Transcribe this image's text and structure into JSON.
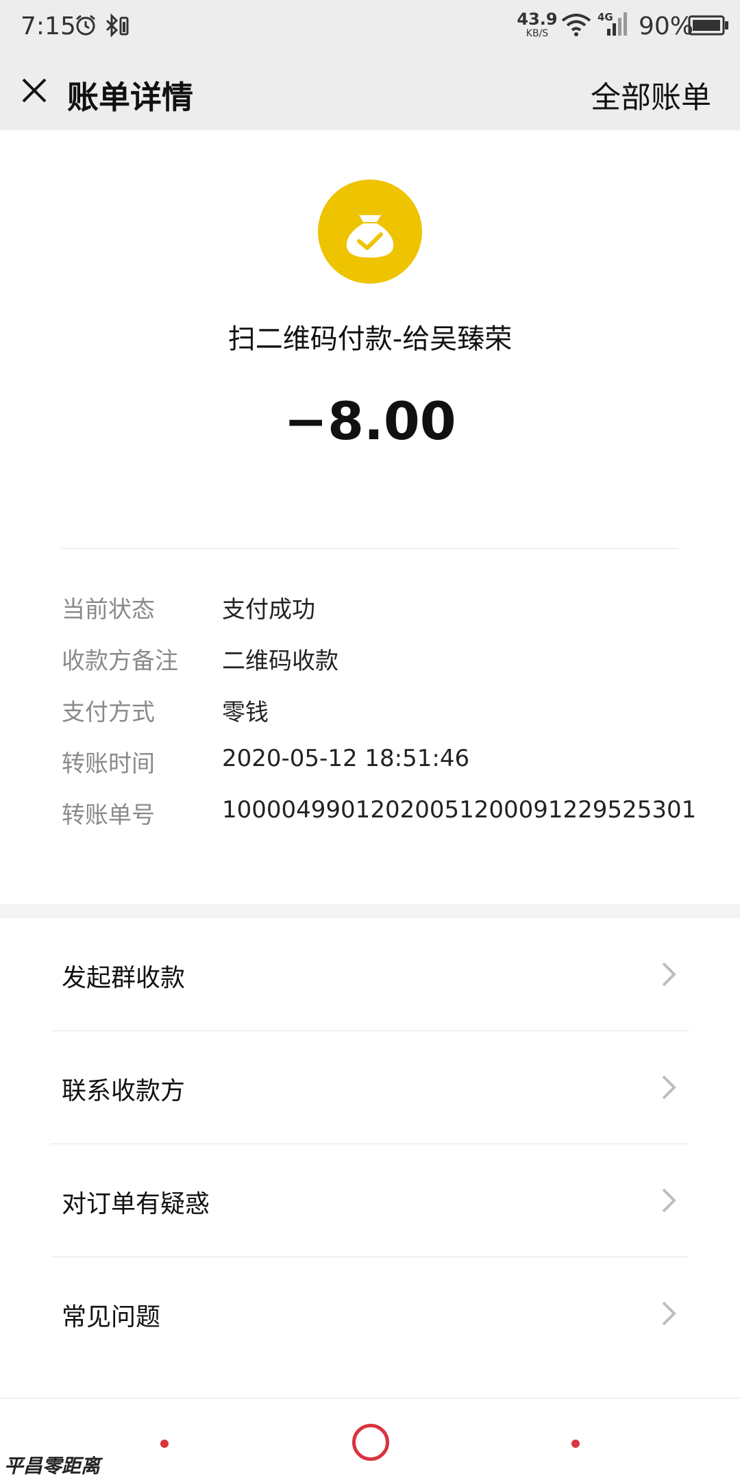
{
  "status_bar": {
    "time": "7:15",
    "net_speed": "43.9",
    "net_speed_unit": "KB/S",
    "network": "4G",
    "battery": "90%",
    "icons": [
      "alarm-icon",
      "bluetooth-icon",
      "wifi-icon",
      "signal-icon",
      "battery-icon"
    ]
  },
  "header": {
    "title": "账单详情",
    "right_link": "全部账单"
  },
  "summary": {
    "icon": "money-bag-icon",
    "icon_color": "#EEC300",
    "description": "扫二维码付款-给吴臻荣",
    "amount": "−8.00"
  },
  "details": [
    {
      "label": "当前状态",
      "value": "支付成功"
    },
    {
      "label": "收款方备注",
      "value": "二维码收款"
    },
    {
      "label": "支付方式",
      "value": "零钱"
    },
    {
      "label": "转账时间",
      "value": "2020-05-12 18:51:46"
    },
    {
      "label": "转账单号",
      "value": "1000049901202005120009122952530​1"
    }
  ],
  "menu": [
    {
      "label": "发起群收款"
    },
    {
      "label": "联系收款方"
    },
    {
      "label": "对订单有疑惑"
    },
    {
      "label": "常见问题"
    }
  ],
  "nav_color": "#D9333F",
  "watermark": "平昌零距离"
}
